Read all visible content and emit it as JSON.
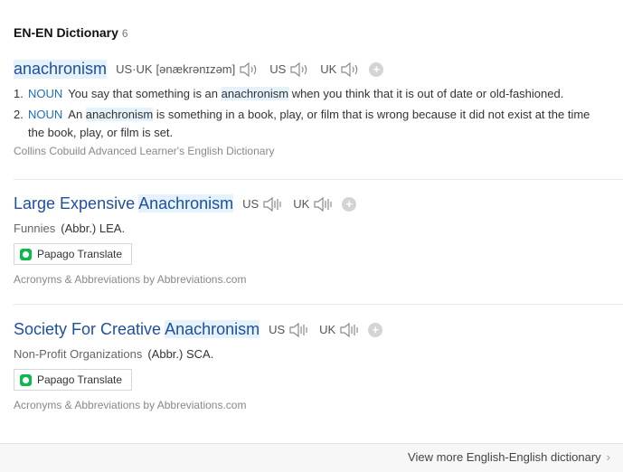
{
  "section": {
    "title": "EN-EN Dictionary",
    "count": "6"
  },
  "entry1": {
    "headword": "anachronism",
    "us_uk_label": "US·UK",
    "phonetic": "[ənækrənɪzəm]",
    "us_label": "US",
    "uk_label": "UK",
    "definitions": [
      {
        "num": "1.",
        "pos": "NOUN",
        "pre": "You say that something is an ",
        "hl": "anachronism",
        "post": " when you think that it is out of date or old-fashioned."
      },
      {
        "num": "2.",
        "pos": "NOUN",
        "pre": "An ",
        "hl": "anachronism",
        "post": " is something in a book, play, or film that is wrong because it did not exist at the time the book, play, or film is set."
      }
    ],
    "source": "Collins Cobuild Advanced Learner's English Dictionary"
  },
  "entry2": {
    "headword_pre": "Large Expensive ",
    "headword_hl": "Anachronism",
    "us_label": "US",
    "uk_label": "UK",
    "category": "Funnies",
    "abbr": "(Abbr.) LEA.",
    "translate_label": "Papago Translate",
    "source": "Acronyms & Abbreviations by Abbreviations.com"
  },
  "entry3": {
    "headword_pre": "Society For Creative ",
    "headword_hl": "Anachronism",
    "us_label": "US",
    "uk_label": "UK",
    "category": "Non-Profit Organizations",
    "abbr": "(Abbr.) SCA.",
    "translate_label": "Papago Translate",
    "source": "Acronyms & Abbreviations by Abbreviations.com"
  },
  "footer": {
    "more_label": "View more English-English dictionary"
  }
}
